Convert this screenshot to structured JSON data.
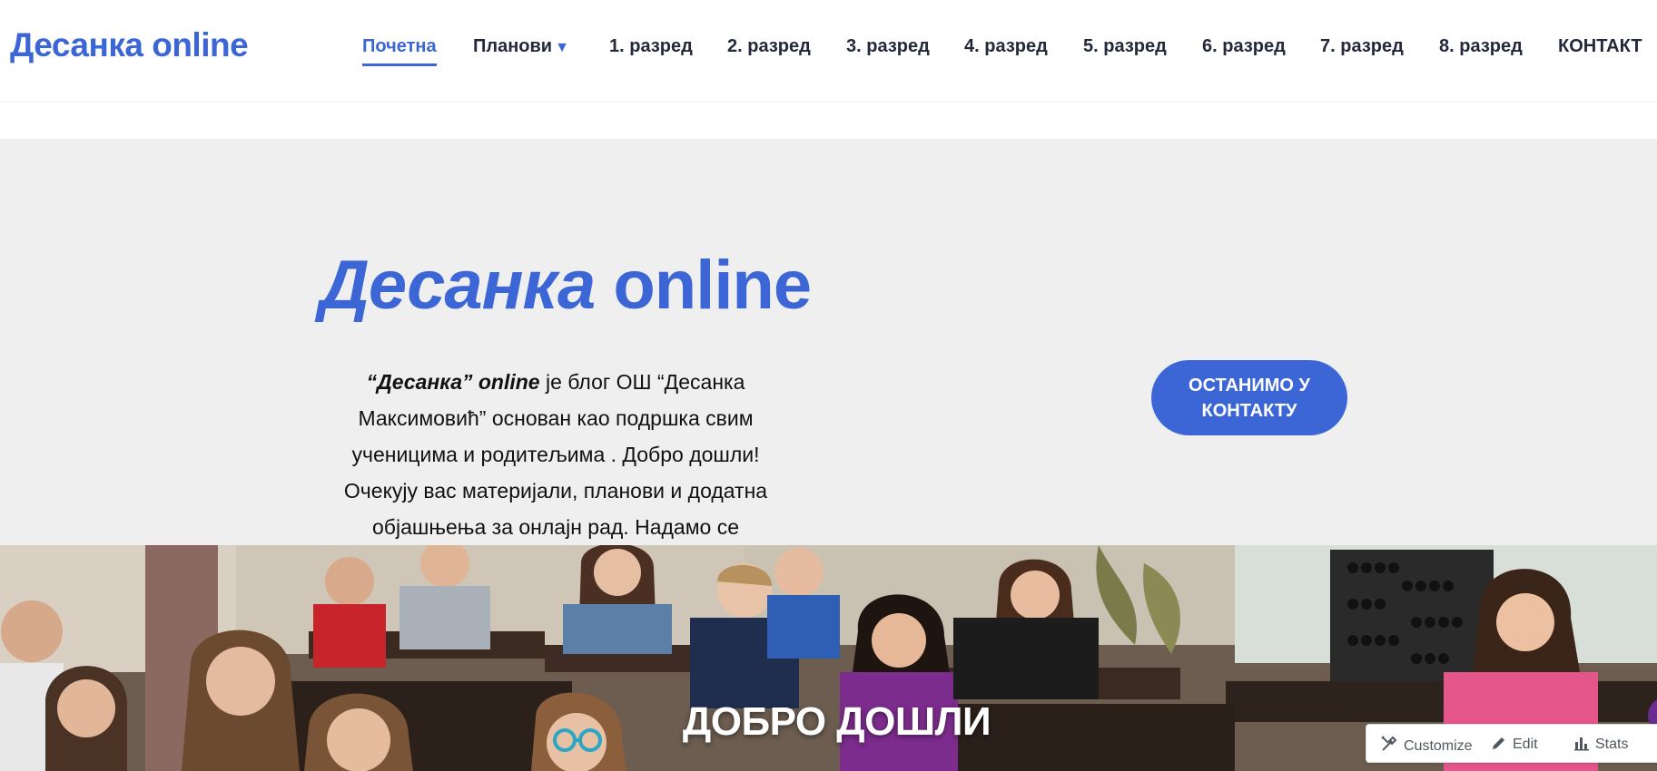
{
  "site": {
    "title": "Десанка online"
  },
  "nav": {
    "items": [
      {
        "label": "Почетна"
      },
      {
        "label": "Планови"
      },
      {
        "label": "1. разред"
      },
      {
        "label": "2. разред"
      },
      {
        "label": "3. разред"
      },
      {
        "label": "4. разред"
      },
      {
        "label": "5. разред"
      },
      {
        "label": "6. разред"
      },
      {
        "label": "7. разред"
      },
      {
        "label": "8. разред"
      },
      {
        "label": "КОНТАКТ"
      }
    ],
    "dropdown_caret": "▼"
  },
  "hero": {
    "title_italic": "Десанка",
    "title_rest": " online",
    "text_lead": "“Десанка” online",
    "text_body": " је блог ОШ “Десанка Максимовић” основан као подршка свим ученицима и родитељима . Добро дошли! Очекују вас материјали, планови и додатна објашњења за онлајн рад. Надамо се успешној сарадњи!",
    "cta_label": "ОСТАНИМО У КОНТАКТУ"
  },
  "banner": {
    "heading": "ДОБРО ДОШЛИ"
  },
  "admin_bar": {
    "customize_label": "Customize",
    "edit_label": "Edit",
    "stats_label": "Stats"
  },
  "colors": {
    "accent": "#3c66d6",
    "hero_bg": "#efefef",
    "text_dark": "#23293a"
  }
}
